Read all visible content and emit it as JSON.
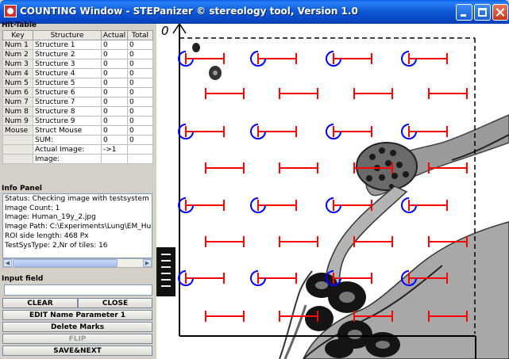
{
  "window": {
    "title": "COUNTING Window - STEPanizer © stereology tool, Version 1.0"
  },
  "hit_table": {
    "title": "Hit-Table",
    "columns": [
      "Key",
      "Structure",
      "Actual",
      "Total"
    ],
    "rows": [
      {
        "key": "Num 1",
        "structure": "Structure 1",
        "actual": "0",
        "total": "0"
      },
      {
        "key": "Num 2",
        "structure": "Structure 2",
        "actual": "0",
        "total": "0"
      },
      {
        "key": "Num 3",
        "structure": "Structure 3",
        "actual": "0",
        "total": "0"
      },
      {
        "key": "Num 4",
        "structure": "Structure 4",
        "actual": "0",
        "total": "0"
      },
      {
        "key": "Num 5",
        "structure": "Structure 5",
        "actual": "0",
        "total": "0"
      },
      {
        "key": "Num 6",
        "structure": "Structure 6",
        "actual": "0",
        "total": "0"
      },
      {
        "key": "Num 7",
        "structure": "Structure 7",
        "actual": "0",
        "total": "0"
      },
      {
        "key": "Num 8",
        "structure": "Structure 8",
        "actual": "0",
        "total": "0"
      },
      {
        "key": "Num 9",
        "structure": "Structure 9",
        "actual": "0",
        "total": "0"
      },
      {
        "key": "Mouse",
        "structure": "Struct Mouse",
        "actual": "0",
        "total": "0"
      },
      {
        "key": "",
        "structure": "SUM:",
        "actual": "0",
        "total": "0"
      },
      {
        "key": "",
        "structure": "Actual Image:",
        "actual": "->1",
        "total": ""
      },
      {
        "key": "",
        "structure": "Image:",
        "actual": "",
        "total": ""
      }
    ]
  },
  "info_panel": {
    "title": "Info Panel",
    "lines": [
      "Status: Checking image with testsystem",
      "Image Count: 1",
      "Image: Human_19y_2.jpg",
      "Image Path: C:\\Experiments\\Lung\\EM_Hum",
      "ROI side length: 468 Px",
      "TestSysType: 2,Nr of tiles: 16"
    ]
  },
  "input": {
    "title": "Input field",
    "value": ""
  },
  "buttons": {
    "clear": "CLEAR",
    "close": "CLOSE",
    "edit_name": "EDIT Name Parameter 1",
    "delete_marks": "Delete Marks",
    "flip": "FLIP",
    "save_next": "SAVE&NEXT"
  },
  "image_view": {
    "origin_label": "0",
    "probe_color": "#ff0000",
    "point_color": "#0000ff"
  }
}
